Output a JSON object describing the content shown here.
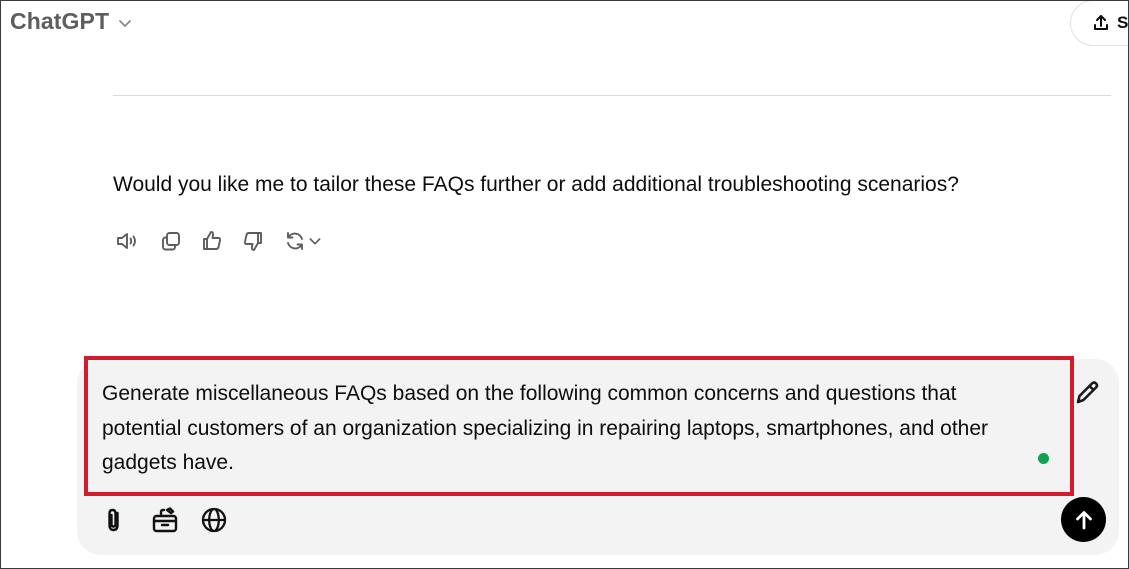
{
  "header": {
    "title": "ChatGPT",
    "model_menu_icon": "chevron-down-icon",
    "share_label": "S",
    "share_icon": "share-icon"
  },
  "conversation": {
    "assistant_message": "Would you like me to tailor these FAQs further or add additional troubleshooting scenarios?",
    "actions": [
      {
        "name": "read-aloud",
        "icon": "speaker-icon"
      },
      {
        "name": "copy",
        "icon": "copy-icon"
      },
      {
        "name": "good-response",
        "icon": "thumbs-up-icon"
      },
      {
        "name": "bad-response",
        "icon": "thumbs-down-icon"
      },
      {
        "name": "regenerate",
        "icon": "refresh-icon"
      }
    ]
  },
  "composer": {
    "prompt_lines": [
      "Generate miscellaneous FAQs based on the following common concerns and questions that",
      "potential customers of an organization specializing in repairing laptops, smartphones, and other",
      "gadgets have."
    ],
    "tools": [
      {
        "name": "attach",
        "icon": "paperclip-icon"
      },
      {
        "name": "tools",
        "icon": "toolbox-icon"
      },
      {
        "name": "search-web",
        "icon": "globe-icon"
      }
    ],
    "send_icon": "arrow-up-icon",
    "highlight_color": "#d21c2b",
    "status_color": "#12a150"
  }
}
